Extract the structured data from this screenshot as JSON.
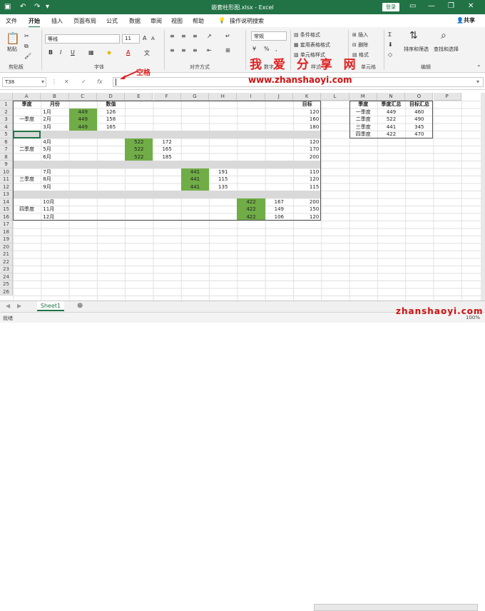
{
  "title": "嵌套柱形图.xlsx - Excel",
  "login": "登录",
  "menu": [
    "文件",
    "开始",
    "插入",
    "页面布局",
    "公式",
    "数据",
    "审阅",
    "视图",
    "帮助"
  ],
  "tell_me": "操作说明搜索",
  "share": "共享",
  "ribbon": {
    "paste": "粘贴",
    "clipboard": "剪贴板",
    "font_name": "等线",
    "font_size": "11",
    "font_group": "字体",
    "align_group": "对齐方式",
    "number_format": "常规",
    "number_group": "数字",
    "cond_format": "条件格式",
    "table_format": "套用表格格式",
    "cell_style": "单元格样式",
    "style_group": "样式",
    "insert": "插入",
    "delete": "删除",
    "format": "格式",
    "cells_group": "单元格",
    "sort_filter": "排序和筛选",
    "find_select": "查找和选择",
    "edit_group": "编辑"
  },
  "watermark": "我 爱 分 享 网",
  "url": "www.zhanshaoyi.com",
  "url_bottom": "zhanshaoyi.com",
  "annotation": "空格",
  "name_box": "T38",
  "columns": [
    "A",
    "B",
    "C",
    "D",
    "E",
    "F",
    "G",
    "H",
    "I",
    "J",
    "K",
    "L",
    "M",
    "N",
    "O",
    "P"
  ],
  "rows": [
    "1",
    "2",
    "3",
    "4",
    "5",
    "6",
    "7",
    "8",
    "9",
    "10",
    "11",
    "12",
    "13",
    "14",
    "15",
    "16",
    "17",
    "18",
    "19",
    "20",
    "21",
    "22",
    "23",
    "24",
    "25",
    "26"
  ],
  "table1": {
    "headers": [
      "季度",
      "月份",
      "",
      "数值",
      "",
      "",
      "",
      "",
      "",
      "",
      "目标"
    ],
    "quarters": [
      "一季度",
      "二季度",
      "三季度",
      "四季度"
    ],
    "months": [
      "1月",
      "2月",
      "3月",
      "4月",
      "5月",
      "6月",
      "7月",
      "8月",
      "9月",
      "10月",
      "11月",
      "12月"
    ],
    "summary_values": [
      [
        "449",
        "449",
        "449"
      ],
      [
        "522",
        "522",
        "522"
      ],
      [
        "441",
        "441",
        "441"
      ],
      [
        "422",
        "422",
        "422"
      ]
    ],
    "values": [
      "126",
      "158",
      "165",
      "172",
      "165",
      "185",
      "191",
      "115",
      "135",
      "167",
      "149",
      "106"
    ],
    "targets": [
      "120",
      "160",
      "180",
      "120",
      "170",
      "200",
      "110",
      "120",
      "115",
      "200",
      "150",
      "120"
    ]
  },
  "table2": {
    "headers": [
      "季度",
      "季度汇总",
      "目标汇总"
    ],
    "rows": [
      [
        "一季度",
        "449",
        "460"
      ],
      [
        "二季度",
        "522",
        "490"
      ],
      [
        "三季度",
        "441",
        "345"
      ],
      [
        "四季度",
        "422",
        "470"
      ]
    ]
  },
  "sheet_tab": "Sheet1",
  "status": "就绪",
  "zoom": "100%",
  "colors": {
    "excel_green": "#217346",
    "highlight": "#70ad47",
    "gray_row": "#d9d9d9",
    "watermark": "#e02020"
  }
}
